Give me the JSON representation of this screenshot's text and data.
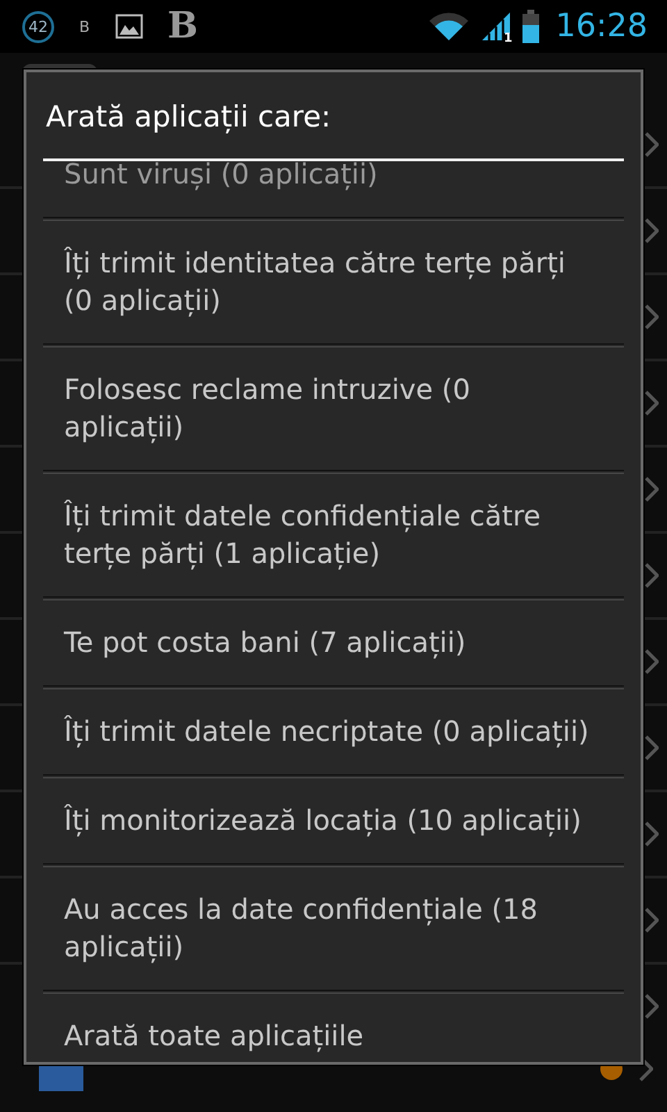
{
  "status_bar": {
    "notification_count": "42",
    "small_letter": "B",
    "big_letter": "B",
    "time": "16:28",
    "signal_sim": "1"
  },
  "background_app": {
    "visible_item": {
      "unread": true
    }
  },
  "dialog": {
    "title": "Arată aplicații care:",
    "options": [
      {
        "label": "Sunt viruși (0 aplicații)"
      },
      {
        "label": "Îți trimit identitatea către terțe părți (0 aplicații)"
      },
      {
        "label": "Folosesc reclame intruzive (0 aplicații)"
      },
      {
        "label": "Îți trimit datele confidențiale către terțe părți (1 aplicație)"
      },
      {
        "label": "Te pot costa bani (7 aplicații)"
      },
      {
        "label": "Îți trimit datele necriptate (0 aplicații)"
      },
      {
        "label": "Îți monitorizează locația (10 aplicații)"
      },
      {
        "label": "Au acces la date confidențiale (18 aplicații)"
      },
      {
        "label": "Arată toate aplicațiile"
      }
    ]
  }
}
